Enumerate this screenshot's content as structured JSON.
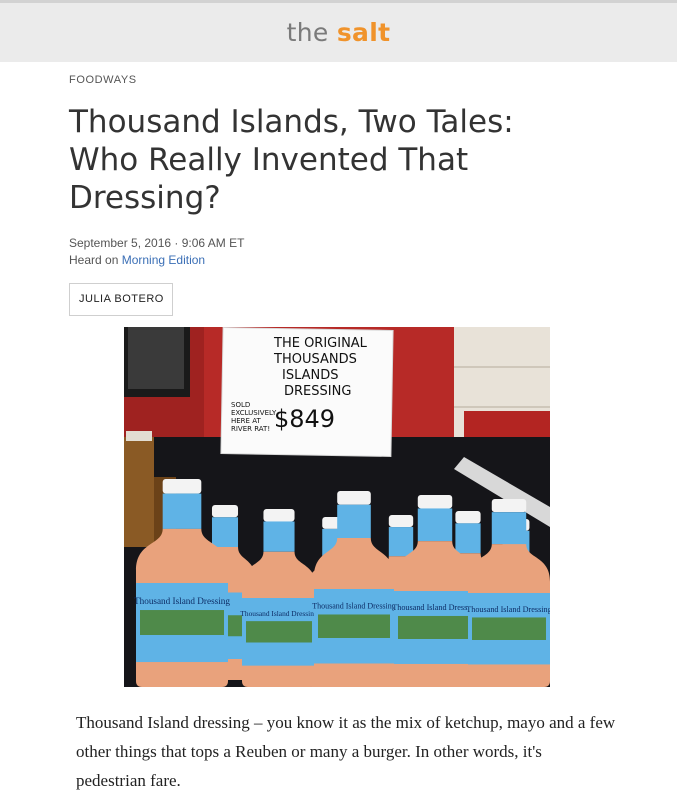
{
  "masthead": {
    "word1": "the",
    "word2": "salt"
  },
  "article": {
    "section": "FOODWAYS",
    "headline": "Thousand Islands, Two Tales: Who Really Invented That Dressing?",
    "date": "September 5, 2016 · 9:06 AM ET",
    "heard_prefix": "Heard on ",
    "program": "Morning Edition",
    "author": "JULIA BOTERO",
    "paragraph": "Thousand Island dressing – you know it as the mix of ketchup, mayo and a few other things that tops a Reuben or many a burger. In other words, it's pedestrian fare."
  },
  "photo": {
    "sign_lines": [
      "THE ORIGINAL",
      "THOUSANDS",
      "ISLANDS",
      "DRESSING"
    ],
    "sign_side": [
      "SOLD",
      "EXCLUSIVELY",
      "HERE AT",
      "RIVER RAT!"
    ],
    "sign_price": "$849",
    "bottle_label": "Thousand Island Dressing",
    "colors": {
      "wall": "#b72a27",
      "dressing": "#e9a27c",
      "label": "#5fb3e6",
      "cap": "#f3f3f3"
    }
  }
}
